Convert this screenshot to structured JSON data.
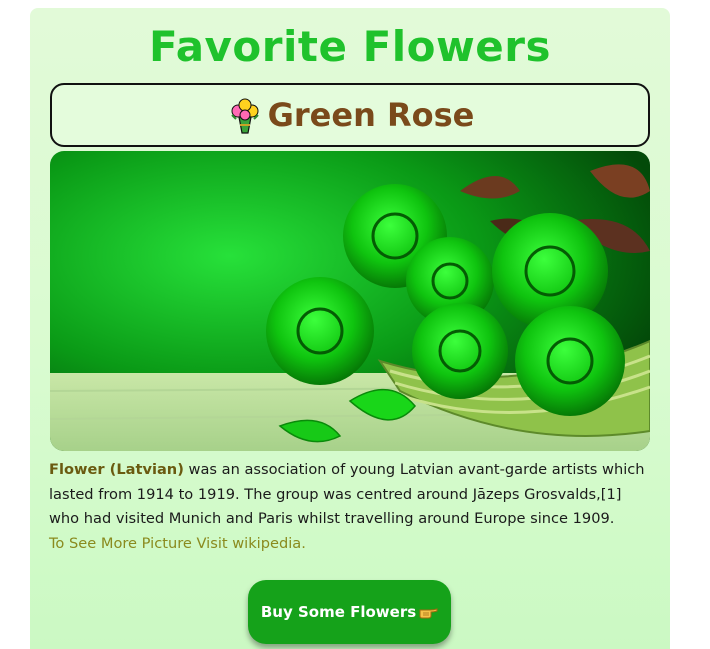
{
  "page": {
    "title": "Favorite Flowers",
    "flower_name": "Green Rose",
    "image_alt": "Green roses in a wicker basket",
    "description": {
      "lead": "Flower (Latvian)",
      "body": " was an association of young Latvian avant-garde artists which lasted from 1914 to 1919. The group was centred around Jāzeps Grosvalds,[1] who had visited Munich and Paris whilst travelling around Europe since 1909.",
      "link_text": "To See More Picture Visit wikipedia."
    },
    "buy_button": {
      "label": "Buy Some Flowers"
    }
  },
  "icons": {
    "bouquet": "bouquet-icon",
    "hand": "pointing-hand-icon"
  },
  "colors": {
    "title": "#1fc22c",
    "flower_name": "#7a4a1b",
    "button": "#15a21a",
    "link": "#8a8a1e",
    "background": "#d9fbd0"
  }
}
